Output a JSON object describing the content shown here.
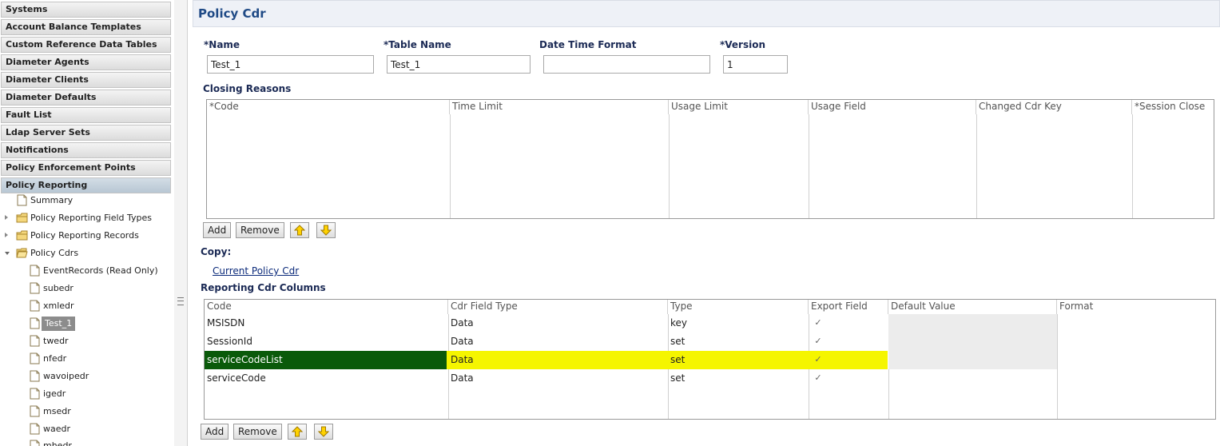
{
  "sidebar": {
    "sections": [
      {
        "label": "Systems"
      },
      {
        "label": "Account Balance Templates"
      },
      {
        "label": "Custom Reference Data Tables"
      },
      {
        "label": "Diameter Agents"
      },
      {
        "label": "Diameter Clients"
      },
      {
        "label": "Diameter Defaults"
      },
      {
        "label": "Fault List"
      },
      {
        "label": "Ldap Server Sets"
      },
      {
        "label": "Notifications"
      },
      {
        "label": "Policy Enforcement Points"
      },
      {
        "label": "Policy Reporting"
      }
    ],
    "tree": [
      {
        "label": "Summary",
        "icon": "page-icon"
      },
      {
        "label": "Policy Reporting Field Types",
        "icon": "folder-icon"
      },
      {
        "label": "Policy Reporting Records",
        "icon": "folder-icon"
      },
      {
        "label": "Policy Cdrs",
        "icon": "folder-open-icon"
      },
      {
        "label": "EventRecords (Read Only)",
        "icon": "page-icon"
      },
      {
        "label": "subedr",
        "icon": "page-icon"
      },
      {
        "label": "xmledr",
        "icon": "page-icon"
      },
      {
        "label": "Test_1",
        "icon": "page-icon"
      },
      {
        "label": "twedr",
        "icon": "page-icon"
      },
      {
        "label": "nfedr",
        "icon": "page-icon"
      },
      {
        "label": "wavoipedr",
        "icon": "page-icon"
      },
      {
        "label": "igedr",
        "icon": "page-icon"
      },
      {
        "label": "msedr",
        "icon": "page-icon"
      },
      {
        "label": "waedr",
        "icon": "page-icon"
      },
      {
        "label": "mhedr",
        "icon": "page-icon"
      }
    ]
  },
  "page": {
    "title": "Policy Cdr"
  },
  "form": {
    "name_label": "*Name",
    "name_value": "Test_1",
    "table_name_label": "*Table Name",
    "table_name_value": "Test_1",
    "date_time_format_label": "Date Time Format",
    "date_time_format_value": "",
    "version_label": "*Version",
    "version_value": "1"
  },
  "closing_reasons": {
    "title": "Closing Reasons",
    "columns": [
      "*Code",
      "Time Limit",
      "Usage Limit",
      "Usage Field",
      "Changed Cdr Key",
      "*Session Close"
    ],
    "add_label": "Add",
    "remove_label": "Remove"
  },
  "copy": {
    "title": "Copy:",
    "link": "Current Policy Cdr"
  },
  "reporting_columns": {
    "title": "Reporting Cdr Columns",
    "columns": [
      "Code",
      "Cdr Field Type",
      "Type",
      "Export Field",
      "Default Value",
      "Format"
    ],
    "rows": [
      {
        "code": "MSISDN",
        "field_type": "Data",
        "type": "key",
        "export": true,
        "default": "",
        "format": ""
      },
      {
        "code": "SessionId",
        "field_type": "Data",
        "type": "set",
        "export": true,
        "default": "",
        "format": ""
      },
      {
        "code": "serviceCodeList",
        "field_type": "Data",
        "type": "set",
        "export": true,
        "default": "",
        "format": "",
        "selected": true
      },
      {
        "code": "serviceCode",
        "field_type": "Data",
        "type": "set",
        "export": true,
        "default": "",
        "format": ""
      }
    ],
    "add_label": "Add",
    "remove_label": "Remove"
  },
  "colors": {
    "title_blue": "#1f4a86",
    "label_navy": "#1b2a55",
    "highlight_yellow": "#f5f500",
    "selected_green": "#0a5a0a"
  }
}
